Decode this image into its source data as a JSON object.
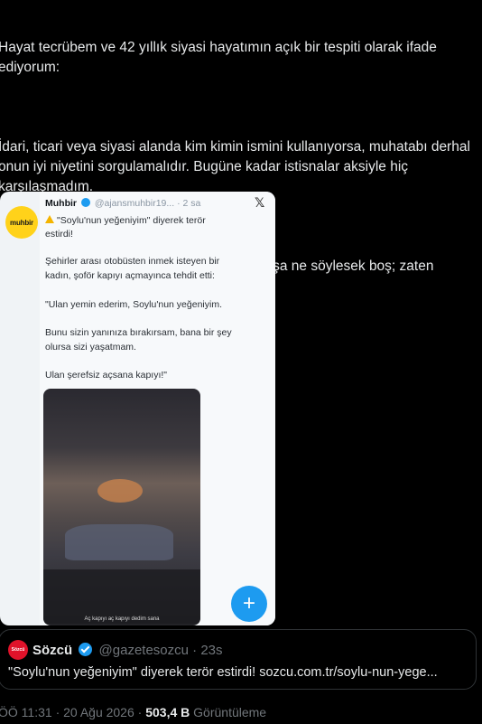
{
  "tweet": {
    "paragraphs": [
      "Hayat tecrübem ve 42 yıllık siyasi hayatımın açık bir tespiti olarak ifade ediyorum:",
      "İdari, ticari veya siyasi alanda kim kimin ismini kullanıyorsa, muhatabı derhal onun iyi niyetini sorgulamalıdır. Bugüne kadar istisnalar aksiyle hiç karşılaşmadım.",
      "Haberciliği tetikçilik seviyesine indiren anlayışa ne söylesek boş; zaten anlamayacaklardır!"
    ]
  },
  "media": {
    "avatar_text": "muhbir",
    "author_name": "Muhbir",
    "author_handle": "@ajansmuhbir19...",
    "time": "· 2 sa",
    "headline_1": "\"Soylu'nun yeğeniyim\" diyerek terör",
    "headline_2": "estirdi!",
    "body_1": "Şehirler arası otobüsten inmek isteyen bir",
    "body_2": "kadın, şoför kapıyı açmayınca tehdit etti:",
    "quote_1": "\"Ulan yemin ederim, Soylu'nun yeğeniyim.",
    "quote_2": "Bunu sizin yanınıza bırakırsam, bana bir şey",
    "quote_3": "olursa sizi yaşatmam.",
    "quote_4": "Ulan şerefsiz açsana kapıyı!\"",
    "video_caption": "Aç kapıyı aç kapıyı dedim sana",
    "fab_label": "+",
    "close_label": "𝕏"
  },
  "quote_card": {
    "avatar_text": "Sözcü",
    "name": "Sözcü",
    "handle": "@gazetesozcu",
    "time": "· 23s",
    "text": "\"Soylu'nun yeğeniyim\" diyerek terör estirdi! sozcu.com.tr/soylu-nun-yege..."
  },
  "meta": {
    "time": "ÖÖ 11:31",
    "date": "20 Ağu 2026",
    "views_count": "503,4 B",
    "views_label": "Görüntüleme"
  },
  "colors": {
    "accent": "#1d9bf0",
    "text": "#e7e9ea",
    "muted": "#71767b",
    "background": "#000000"
  }
}
